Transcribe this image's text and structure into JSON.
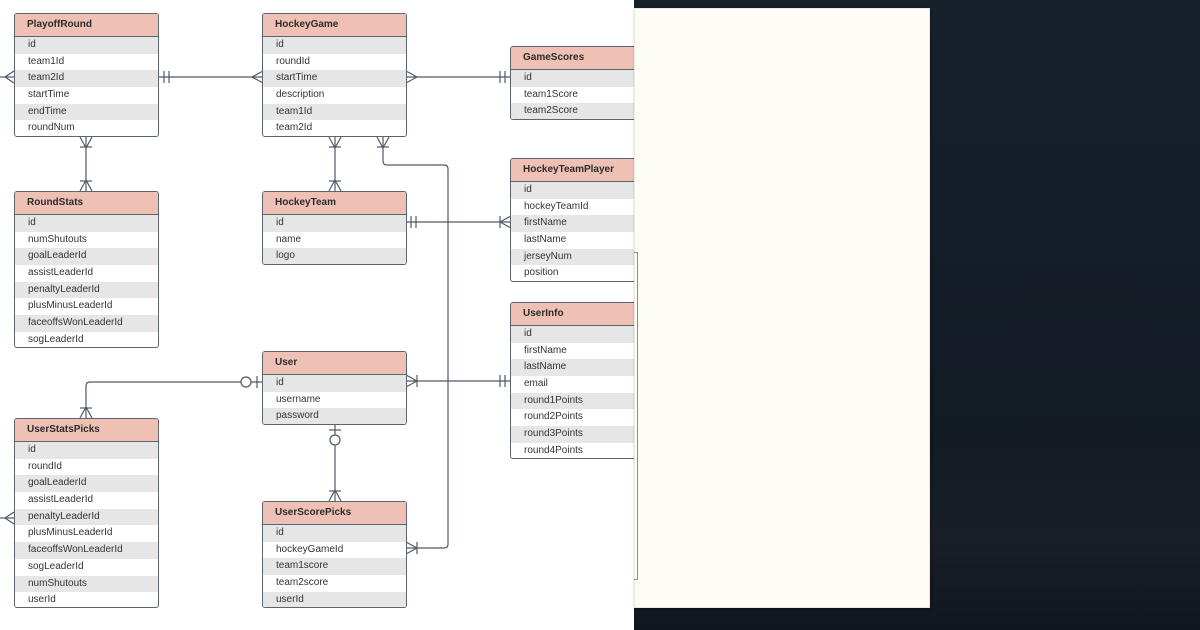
{
  "diagram": {
    "entities": {
      "playoff_round": {
        "title": "PlayoffRound",
        "fields": [
          "id",
          "team1Id",
          "team2Id",
          "startTime",
          "endTime",
          "roundNum"
        ]
      },
      "hockey_game": {
        "title": "HockeyGame",
        "fields": [
          "id",
          "roundId",
          "startTime",
          "description",
          "team1Id",
          "team2Id"
        ]
      },
      "game_scores": {
        "title": "GameScores",
        "fields": [
          "id",
          "team1Score",
          "team2Score"
        ]
      },
      "round_stats": {
        "title": "RoundStats",
        "fields": [
          "id",
          "numShutouts",
          "goalLeaderId",
          "assistLeaderId",
          "penaltyLeaderId",
          "plusMinusLeaderId",
          "faceoffsWonLeaderId",
          "sogLeaderId"
        ]
      },
      "hockey_team": {
        "title": "HockeyTeam",
        "fields": [
          "id",
          "name",
          "logo"
        ]
      },
      "hockey_team_player": {
        "title": "HockeyTeamPlayer",
        "fields": [
          "id",
          "hockeyTeamId",
          "firstName",
          "lastName",
          "jerseyNum",
          "position"
        ]
      },
      "user_info": {
        "title": "UserInfo",
        "fields": [
          "id",
          "firstName",
          "lastName",
          "email",
          "round1Points",
          "round2Points",
          "round3Points",
          "round4Points"
        ]
      },
      "user": {
        "title": "User",
        "fields": [
          "id",
          "username",
          "password"
        ]
      },
      "user_stats_picks": {
        "title": "UserStatsPicks",
        "fields": [
          "id",
          "roundId",
          "goalLeaderId",
          "assistLeaderId",
          "penaltyLeaderId",
          "plusMinusLeaderId",
          "faceoffsWonLeaderId",
          "sogLeaderId",
          "numShutouts",
          "userId"
        ]
      },
      "user_score_picks": {
        "title": "UserScorePicks",
        "fields": [
          "id",
          "hockeyGameId",
          "team1score",
          "team2score",
          "userId"
        ]
      }
    },
    "relationships": [
      {
        "from": "PlayoffRound",
        "to": "HockeyGame",
        "from_card": "one",
        "to_card": "many"
      },
      {
        "from": "HockeyGame",
        "to": "GameScores",
        "from_card": "many",
        "to_card": "one"
      },
      {
        "from": "PlayoffRound",
        "to": "RoundStats",
        "from_card": "many",
        "to_card": "many"
      },
      {
        "from": "HockeyGame",
        "to": "HockeyTeam",
        "from_card": "many",
        "to_card": "many"
      },
      {
        "from": "HockeyTeam",
        "to": "HockeyTeamPlayer",
        "from_card": "one",
        "to_card": "many"
      },
      {
        "from": "HockeyGame",
        "to": "UserScorePicks",
        "from_card": "many",
        "to_card": "many"
      },
      {
        "from": "User",
        "to": "UserInfo",
        "from_card": "many",
        "to_card": "one"
      },
      {
        "from": "User",
        "to": "UserStatsPicks",
        "from_card": "zero-or-one",
        "to_card": "many"
      },
      {
        "from": "User",
        "to": "UserScorePicks",
        "from_card": "zero-or-one",
        "to_card": "many"
      }
    ],
    "colors": {
      "header": "#efc1b4",
      "stripe": "#e6e6e6",
      "line": "#5b6570"
    }
  }
}
